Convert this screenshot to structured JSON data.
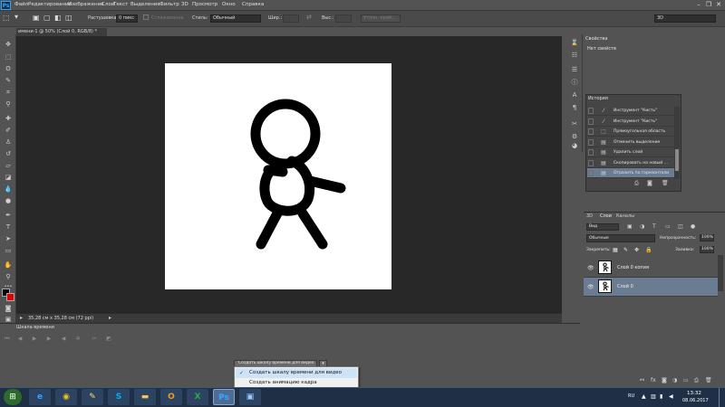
{
  "app": {
    "logo": "Ps"
  },
  "menu": [
    "Файл",
    "Редактирование",
    "Изображение",
    "Слои",
    "Текст",
    "Выделение",
    "Фильтр",
    "3D",
    "Просмотр",
    "Окно",
    "Справка"
  ],
  "options": {
    "feather_label": "Растушевка:",
    "feather_value": "0 пикс",
    "antialias_label": "Сглаживание",
    "style_label": "Стиль:",
    "style_value": "Обычный",
    "width_label": "Шир.:",
    "height_label": "Выс.:",
    "refine_label": "Уточн. край...",
    "workspace": "3D"
  },
  "document": {
    "tab": "имени-1 @ 50% (Слой 0, RGB/8) *",
    "status": "35,28 см x 35,28 см (72 ppi)"
  },
  "timeline": {
    "tab": "Шкала времени",
    "create_button": "Создать шкалу времени для видео",
    "menu": [
      {
        "label": "Создать шкалу времени для видео",
        "checked": true
      },
      {
        "label": "Создать анимацию кадра",
        "checked": false
      }
    ]
  },
  "properties": {
    "tab": "Свойства",
    "empty": "Нет свойств"
  },
  "history": {
    "tab": "История",
    "items": [
      {
        "label": "Инструмент \"Кисть\"",
        "icon": "brush-icon"
      },
      {
        "label": "Инструмент \"Кисть\"",
        "icon": "brush-icon"
      },
      {
        "label": "Прямоугольная область",
        "icon": "marquee-icon"
      },
      {
        "label": "Отменить выделение",
        "icon": "document-icon"
      },
      {
        "label": "Удалить слой",
        "icon": "document-icon"
      },
      {
        "label": "Скопировать на новый ...",
        "icon": "document-icon"
      },
      {
        "label": "Отразить по горизонтали",
        "icon": "document-icon"
      }
    ],
    "selected": 6
  },
  "layers": {
    "tabs": [
      "3D",
      "Слои",
      "Каналы"
    ],
    "kind": "Вид",
    "blend_mode": "Обычные",
    "opacity_label": "Непрозрачность:",
    "opacity_value": "100%",
    "lock_label": "Закрепить:",
    "fill_label": "Заливка:",
    "fill_value": "100%",
    "items": [
      {
        "name": "Слой 0 копия",
        "selected": false
      },
      {
        "name": "Слой 0",
        "selected": true
      }
    ]
  },
  "taskbar": {
    "lang": "RU",
    "time": "13:32",
    "date": "08.06.2017",
    "apps": [
      {
        "icon": "ie-icon",
        "glyph": "e",
        "color": "#3aa0ff"
      },
      {
        "icon": "chrome-icon",
        "glyph": "◉",
        "color": "#f2c018"
      },
      {
        "icon": "paint-icon",
        "glyph": "✎",
        "color": "#ffd86b"
      },
      {
        "icon": "skype-icon",
        "glyph": "S",
        "color": "#00aff0"
      },
      {
        "icon": "folder-icon",
        "glyph": "▬",
        "color": "#f3c65a"
      },
      {
        "icon": "outlook-icon",
        "glyph": "O",
        "color": "#f29b1c"
      },
      {
        "icon": "excel-icon",
        "glyph": "X",
        "color": "#2da84c"
      },
      {
        "icon": "photoshop-icon",
        "glyph": "Ps",
        "color": "#31a8ff"
      },
      {
        "icon": "explorer-window-icon",
        "glyph": "▣",
        "color": "#9ac8ff"
      }
    ]
  }
}
